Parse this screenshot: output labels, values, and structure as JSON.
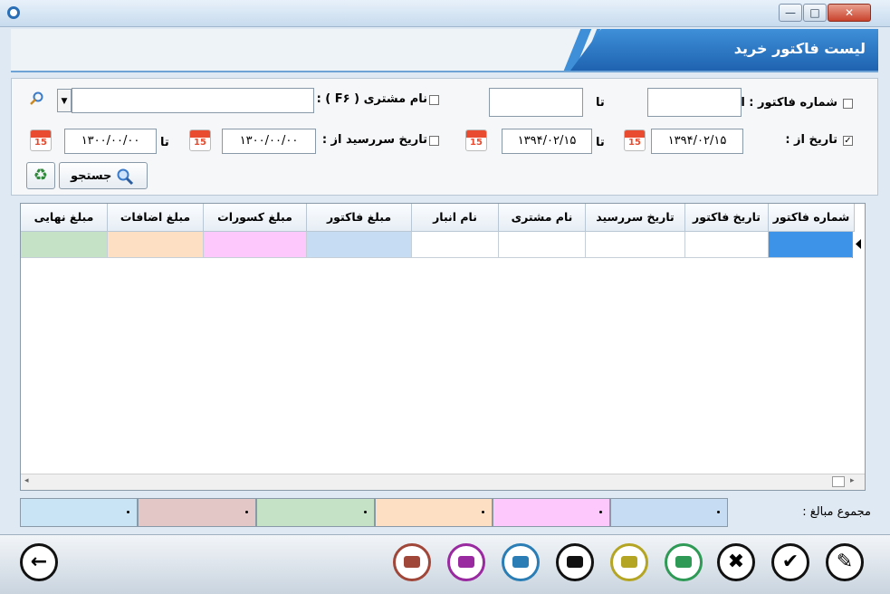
{
  "window": {
    "minimize": "—",
    "maximize": "□",
    "close": "✕"
  },
  "header": {
    "title": "لیست فاکتور خرید"
  },
  "filters": {
    "invoice_no_from_label": "شماره فاکتور : از",
    "invoice_no_from_value": "",
    "to_label": "تا",
    "invoice_no_to_value": "",
    "customer_label": "نام مشتری ( F۶ ) :",
    "customer_value": "",
    "date_from_label": "تاریخ از :",
    "date_from_value": "۱۳۹۴/۰۲/۱۵",
    "date_to_value": "۱۳۹۴/۰۲/۱۵",
    "due_from_label": "تاریخ سررسید از :",
    "due_from_value": "۱۳۰۰/۰۰/۰۰",
    "due_to_value": "۱۳۰۰/۰۰/۰۰",
    "calendar_number": "15",
    "search_label": "جستجو",
    "invoice_no_checked": false,
    "customer_checked": false,
    "date_checked": true,
    "due_checked": false
  },
  "grid": {
    "columns": [
      "شماره فاکتور",
      "تاریخ فاکتور",
      "تاریخ سررسید",
      "نام مشتری",
      "نام انبار",
      "مبلغ فاکتور",
      "مبلغ کسورات",
      "مبلغ اضافات",
      "مبلغ نهایی"
    ]
  },
  "totals": {
    "label": "مجموع مبالغ :"
  },
  "colors": {
    "accent": "#1f63b0",
    "final_amount": "#c6e2c6",
    "additions": "#fde0c4",
    "deductions": "#fdc8fb",
    "invoice_amount": "#c6dcf2",
    "selected_cell": "#3c93e8"
  },
  "toolbar_icons": [
    "back-arrow-icon",
    "printer-icon",
    "printer-icon",
    "printer-icon",
    "printer-icon",
    "printer-icon",
    "card-printer-icon",
    "delete-icon",
    "confirm-icon",
    "edit-icon"
  ]
}
